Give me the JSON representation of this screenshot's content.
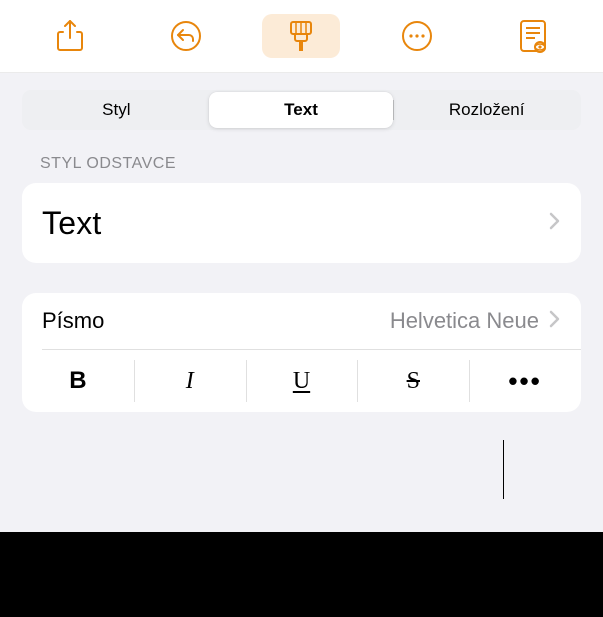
{
  "toolbar": {
    "share": "share-icon",
    "undo": "undo-icon",
    "format": "format-brush-icon",
    "more": "more-icon",
    "readmode": "readmode-icon"
  },
  "segmented": {
    "items": [
      "Styl",
      "Text",
      "Rozložení"
    ],
    "selected": 1
  },
  "section": {
    "paragraph_style_label": "STYL ODSTAVCE",
    "paragraph_style_value": "Text"
  },
  "font": {
    "label": "Písmo",
    "value": "Helvetica Neue"
  },
  "style_buttons": {
    "bold": "B",
    "italic": "I",
    "underline": "U",
    "strike": "S",
    "more": "•••"
  },
  "accent_color": "#E8860C"
}
